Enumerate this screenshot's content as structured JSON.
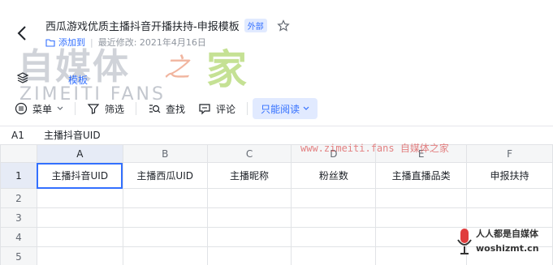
{
  "header": {
    "title": "西瓜游戏优质主播抖音开播扶持-申报模板",
    "badge": "外部",
    "folder_label": "添加到",
    "modified_label": "最近修改: 2021年4月16日"
  },
  "watermark": {
    "logo_cn": "自媒体",
    "logo_zhi": "之",
    "logo_jia": "家",
    "logo_en": "ZIMEITI FANS",
    "url_text": "www.zimeiti.fans 自媒体之家",
    "br_top": "人人都是自媒体",
    "br_bottom": "woshizmt.cn"
  },
  "template_label": "模板",
  "toolbar": {
    "menu_label": "菜单",
    "filter_label": "筛选",
    "find_label": "查找",
    "comment_label": "评论",
    "readonly_label": "只能阅读"
  },
  "formula_bar": {
    "cell_ref": "A1",
    "value": "主播抖音UID"
  },
  "grid": {
    "columns": [
      "A",
      "B",
      "C",
      "D",
      "E",
      "F"
    ],
    "rows": [
      "1",
      "2",
      "3",
      "4",
      "5"
    ],
    "row1": [
      "主播抖音UID",
      "主播西瓜UID",
      "主播昵称",
      "粉丝数",
      "主播直播品类",
      "申报扶持"
    ]
  },
  "colors": {
    "accent": "#3370ff",
    "selected_header": "#e6ebf6"
  }
}
